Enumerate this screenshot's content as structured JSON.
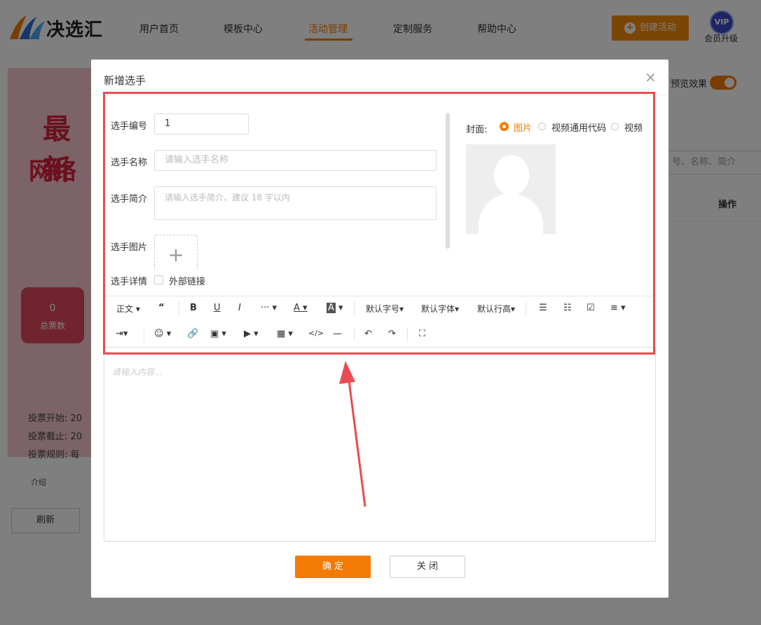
{
  "header": {
    "logo_text": "决选汇",
    "nav": [
      "用户首页",
      "模板中心",
      "活动管理",
      "定制服务",
      "帮助中心"
    ],
    "active_nav_index": 2,
    "create_button": "创建活动",
    "vip_badge": "VIP",
    "vip_label": "会员升级"
  },
  "background": {
    "banner_line1": "最新",
    "banner_line2": "网络",
    "card_value": "0",
    "card_label": "总票数",
    "stats": [
      "投票开始: 20",
      "投票截止: 20",
      "投票规则: 每"
    ],
    "preview_label": "预览效果",
    "search_placeholder": "号、名称、简介",
    "col_operation": "操作",
    "intro_label": "介绍",
    "refresh_button": "刷新"
  },
  "modal": {
    "title": "新增选手",
    "close_glyph": "×",
    "form": {
      "number_label": "选手编号",
      "number_value": "1",
      "name_label": "选手名称",
      "name_placeholder": "请输入选手名称",
      "intro_label": "选手简介",
      "intro_placeholder": "请输入选手简介、建议 18 字以内",
      "image_label": "选手图片",
      "detail_label": "选手详情",
      "external_link_label": "外部链接"
    },
    "cover": {
      "label": "封面:",
      "options": [
        "图片",
        "视频通用代码",
        "视频"
      ],
      "selected_index": 0
    },
    "toolbar_row1": [
      "正文",
      "“",
      "B",
      "U",
      "I",
      "···",
      "A",
      "A",
      "默认字号",
      "默认字体",
      "默认行高",
      "☰",
      "☷",
      "☑",
      "≡"
    ],
    "toolbar_row2": [
      "⇥",
      "☺",
      "🔗",
      "▣",
      "▶",
      "▦",
      "</>",
      "—",
      "↶",
      "↷",
      "⛶"
    ],
    "editor_placeholder": "请输入内容...",
    "confirm_button": "确 定",
    "close_button": "关 闭"
  },
  "colors": {
    "accent": "#f27a05",
    "highlight_border": "#ea4b52"
  }
}
